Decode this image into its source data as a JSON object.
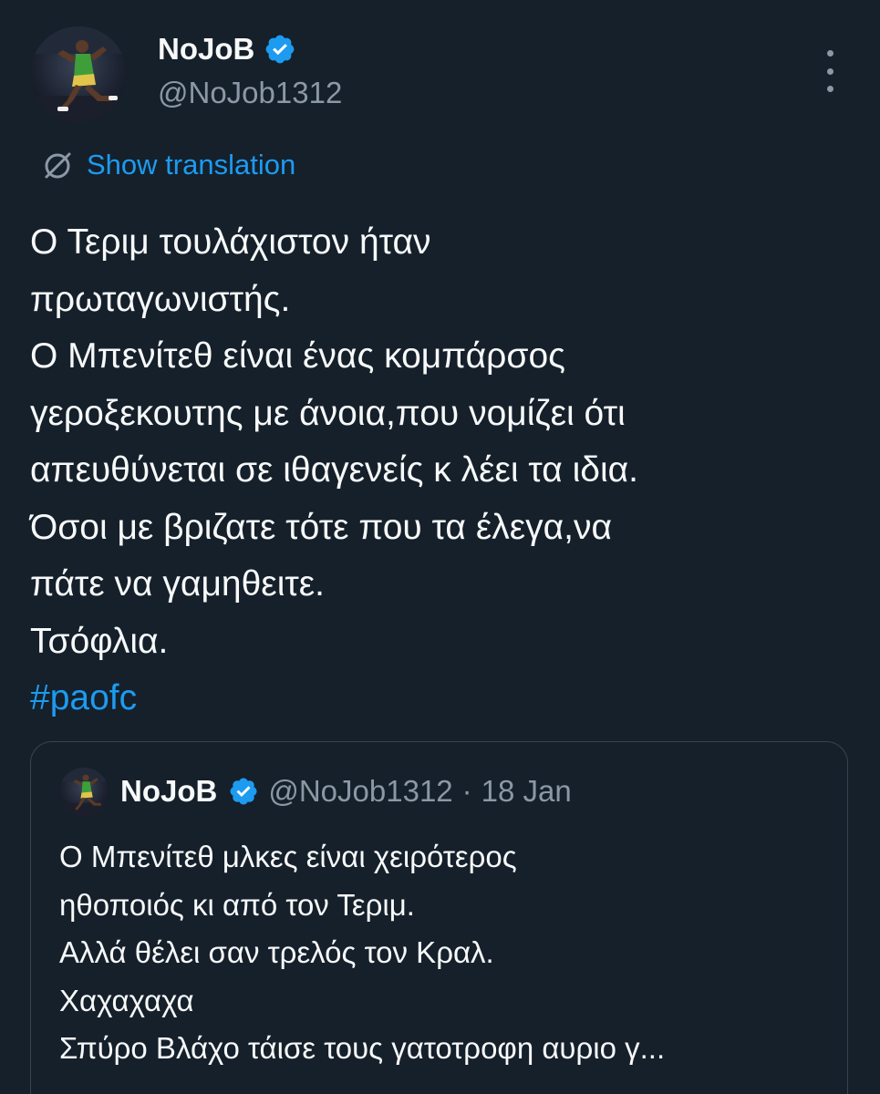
{
  "tweet": {
    "display_name": "NoJoB",
    "handle": "@NoJob1312",
    "translation_label": "Show translation",
    "text_lines": [
      "Ο Τεριμ τουλάχιστον ήταν",
      "πρωταγωνιστής.",
      "Ο Μπενίτεθ είναι ένας κομπάρσος",
      "γεροξεκουτης με άνοια,που νομίζει ότι",
      "απευθύνεται σε ιθαγενείς κ λέει τα ιδια.",
      "Όσοι με βριζατε τότε που τα έλεγα,να",
      "πάτε να γαμηθειτε.",
      "Τσόφλια."
    ],
    "hashtag": "#paofc"
  },
  "quoted": {
    "display_name": "NoJoB",
    "handle": "@NoJob1312",
    "separator": "·",
    "time": "18 Jan",
    "text_lines": [
      "Ο Μπενίτεθ μλκες είναι χειρότερος",
      "ηθοποιός  κι από τον Τεριμ.",
      "Αλλά θέλει σαν τρελός τον Κραλ.",
      "Χαχαχαχα",
      "Σπύρο Βλάχο τάισε τους γατοτροφη αυριο γ..."
    ]
  },
  "icons": {
    "verified": "verified-badge-icon",
    "translate": "translate-icon",
    "more": "more-options-icon"
  },
  "colors": {
    "background": "#15202b",
    "text": "#f7f9f9",
    "secondary": "#8b98a5",
    "accent": "#1d9bf0",
    "border": "#38444d"
  }
}
